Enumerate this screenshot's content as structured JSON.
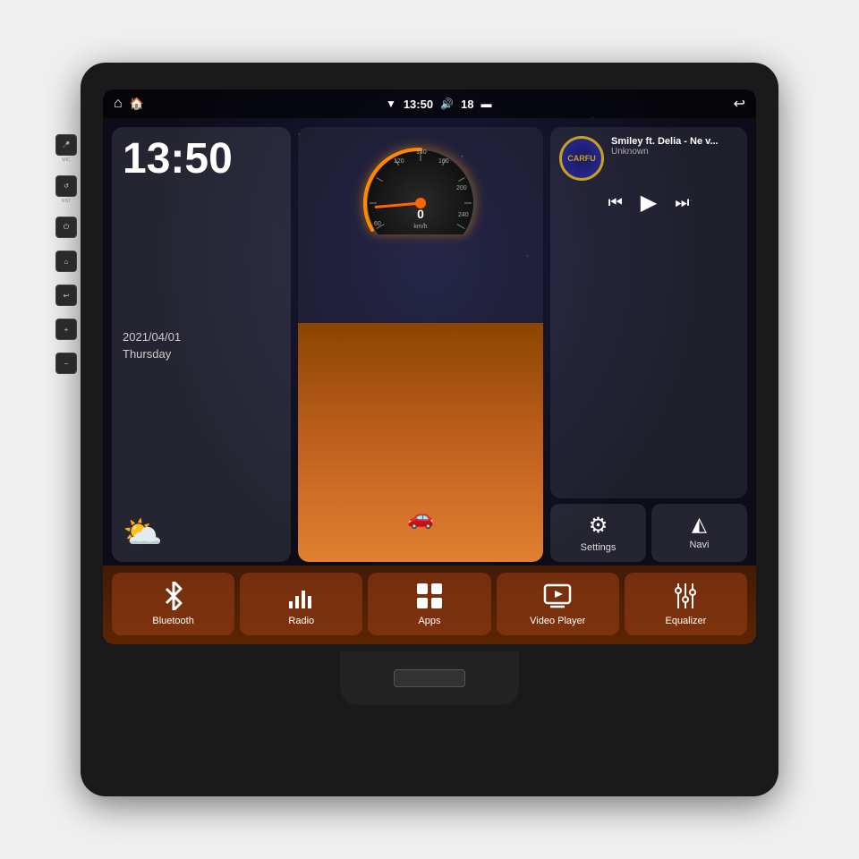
{
  "unit": {
    "background_color": "#1a1a1a"
  },
  "status_bar": {
    "left_icons": [
      "🏠",
      "⌂"
    ],
    "time": "13:50",
    "signal_icon": "▼",
    "volume": "18",
    "battery_icon": "▬",
    "back_icon": "↩"
  },
  "clock": {
    "time": "13:50",
    "date": "2021/04/01",
    "day": "Thursday"
  },
  "music": {
    "title": "Smiley ft. Delia - Ne v...",
    "artist": "Unknown",
    "logo_text": "CARFU"
  },
  "settings_btn": {
    "label": "Settings",
    "icon": "⚙"
  },
  "navi_btn": {
    "label": "Navi",
    "icon": "◭"
  },
  "menu": {
    "items": [
      {
        "id": "bluetooth",
        "label": "Bluetooth",
        "icon": "bluetooth"
      },
      {
        "id": "radio",
        "label": "Radio",
        "icon": "radio"
      },
      {
        "id": "apps",
        "label": "Apps",
        "icon": "apps"
      },
      {
        "id": "video-player",
        "label": "Video Player",
        "icon": "video"
      },
      {
        "id": "equalizer",
        "label": "Equalizer",
        "icon": "equalizer"
      }
    ]
  },
  "side_buttons": [
    {
      "id": "mic",
      "label": "MIC"
    },
    {
      "id": "rst",
      "label": "RST"
    },
    {
      "id": "power",
      "label": ""
    },
    {
      "id": "home",
      "label": ""
    },
    {
      "id": "back",
      "label": ""
    },
    {
      "id": "vol-up",
      "label": ""
    },
    {
      "id": "vol-down",
      "label": ""
    }
  ]
}
